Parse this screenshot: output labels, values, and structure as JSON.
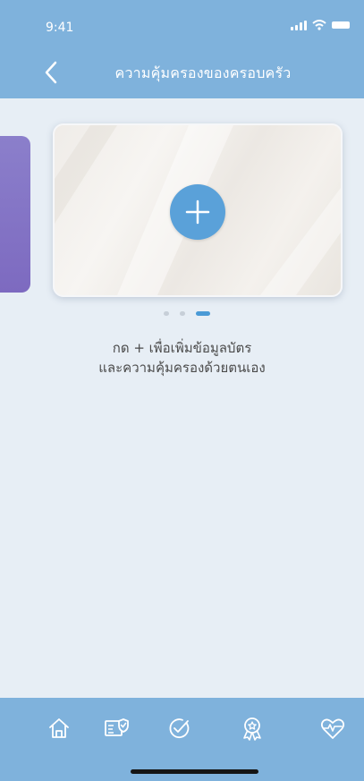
{
  "status_bar": {
    "time": "9:41"
  },
  "header": {
    "title": "ความคุ้มครองของครอบครัว"
  },
  "main": {
    "hint_line1": "กด + เพื่อเพิ่มข้อมูลบัตร",
    "hint_line2": "และความคุ้มครองด้วยตนเอง",
    "carousel": {
      "total": 3,
      "active_index": 2
    }
  },
  "tabbar": {
    "items": [
      {
        "icon": "home-icon"
      },
      {
        "icon": "policy-card-icon"
      },
      {
        "icon": "check-circle-icon"
      },
      {
        "icon": "award-ribbon-icon"
      },
      {
        "icon": "heart-pulse-icon"
      }
    ]
  },
  "colors": {
    "header_bg": "#7fb2dc",
    "page_bg": "#e7eef5",
    "accent": "#5aa1d9",
    "side_card": "#8b7fcb"
  }
}
